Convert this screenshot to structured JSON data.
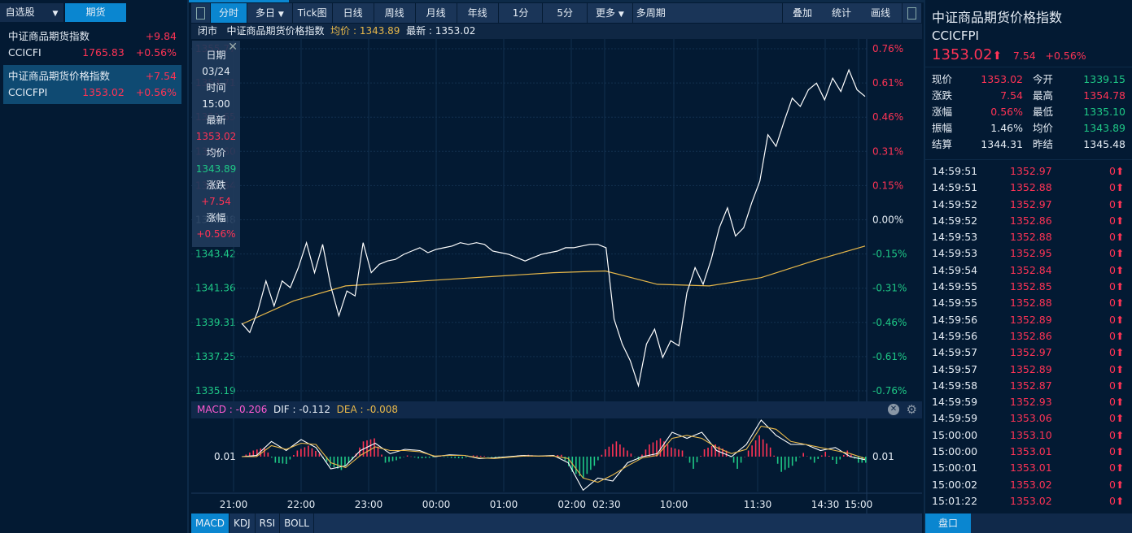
{
  "top_tabs": {
    "watchlist": "自选股",
    "futures": "期货"
  },
  "watchlist": [
    {
      "name": "中证商品期货指数",
      "code": "CCICFI",
      "price": "1765.83",
      "change": "+9.84",
      "pct": "+0.56%"
    },
    {
      "name": "中证商品期货价格指数",
      "code": "CCICFPI",
      "price": "1353.02",
      "change": "+7.54",
      "pct": "+0.56%"
    }
  ],
  "toolbar": {
    "items": [
      "分时",
      "多日",
      "Tick图",
      "日线",
      "周线",
      "月线",
      "年线",
      "1分",
      "5分",
      "更多",
      "多周期"
    ],
    "right": [
      "叠加",
      "统计",
      "画线"
    ]
  },
  "chart_header": {
    "status": "闭市",
    "name": "中证商品期货价格指数",
    "avg_label": "均价 : ",
    "avg": "1343.89",
    "last_label": "最新 : ",
    "last": "1353.02"
  },
  "tooltip": {
    "date_label": "日期",
    "date": "03/24",
    "time_label": "时间",
    "time": "15:00",
    "last_label": "最新",
    "last": "1353.02",
    "avg_label": "均价",
    "avg": "1343.89",
    "chg_label": "涨跌",
    "chg": "+7.54",
    "pct_label": "涨幅",
    "pct": "+0.56%"
  },
  "macd_header": {
    "macd": "MACD : -0.206",
    "dif": "DIF : -0.112",
    "dea": "DEA : -0.008"
  },
  "bottom_tabs": [
    "MACD",
    "KDJ",
    "RSI",
    "BOLL"
  ],
  "right_panel": {
    "name": "中证商品期货价格指数",
    "code": "CCICFPI",
    "price": "1353.02",
    "change": "7.54",
    "pct": "+0.56%",
    "stats": [
      [
        "现价",
        "1353.02",
        "red",
        "今开",
        "1339.15",
        "green"
      ],
      [
        "涨跌",
        "7.54",
        "red",
        "最高",
        "1354.78",
        "red"
      ],
      [
        "涨幅",
        "0.56%",
        "red",
        "最低",
        "1335.10",
        "green"
      ],
      [
        "振幅",
        "1.46%",
        "white",
        "均价",
        "1343.89",
        "green"
      ],
      [
        "结算",
        "1344.31",
        "white",
        "昨结",
        "1345.48",
        "white"
      ]
    ],
    "trades": [
      [
        "14:59:51",
        "1352.97",
        "0"
      ],
      [
        "14:59:51",
        "1352.88",
        "0"
      ],
      [
        "14:59:52",
        "1352.97",
        "0"
      ],
      [
        "14:59:52",
        "1352.86",
        "0"
      ],
      [
        "14:59:53",
        "1352.88",
        "0"
      ],
      [
        "14:59:53",
        "1352.95",
        "0"
      ],
      [
        "14:59:54",
        "1352.84",
        "0"
      ],
      [
        "14:59:55",
        "1352.85",
        "0"
      ],
      [
        "14:59:55",
        "1352.88",
        "0"
      ],
      [
        "14:59:56",
        "1352.89",
        "0"
      ],
      [
        "14:59:56",
        "1352.86",
        "0"
      ],
      [
        "14:59:57",
        "1352.97",
        "0"
      ],
      [
        "14:59:57",
        "1352.89",
        "0"
      ],
      [
        "14:59:58",
        "1352.87",
        "0"
      ],
      [
        "14:59:59",
        "1352.93",
        "0"
      ],
      [
        "14:59:59",
        "1353.06",
        "0"
      ],
      [
        "15:00:00",
        "1353.10",
        "0"
      ],
      [
        "15:00:00",
        "1353.01",
        "0"
      ],
      [
        "15:00:01",
        "1353.01",
        "0"
      ],
      [
        "15:00:02",
        "1353.02",
        "0"
      ],
      [
        "15:01:22",
        "1353.02",
        "0"
      ]
    ],
    "tab": "盘口"
  },
  "colors": {
    "up": "#ff3355",
    "down": "#1ec886",
    "avg": "#e8b84a",
    "accent": "#0a86d0"
  },
  "chart_data": [
    {
      "type": "line",
      "title": "分时",
      "ylim": [
        1335.19,
        1355.77
      ],
      "y_ticks": [
        "1355.77",
        "1353.71",
        "1351.65",
        "1349.60",
        "1347.54",
        "1345.48",
        "1343.42",
        "1341.36",
        "1339.31",
        "1337.25",
        "1335.19"
      ],
      "pct_ticks": [
        "0.76%",
        "0.61%",
        "0.46%",
        "0.31%",
        "0.15%",
        "0.00%",
        "-0.15%",
        "-0.31%",
        "-0.46%",
        "-0.61%",
        "-0.76%"
      ],
      "x_ticks": [
        "21:00",
        "22:00",
        "23:00",
        "00:00",
        "01:00",
        "02:00",
        "02:30",
        "10:00",
        "11:30",
        "14:30",
        "15:00"
      ],
      "series": [
        {
          "name": "price",
          "values": [
            1339.25,
            1338.7,
            1340.0,
            1341.8,
            1340.3,
            1341.8,
            1341.4,
            1342.6,
            1344.1,
            1342.3,
            1344.0,
            1341.5,
            1339.7,
            1341.2,
            1340.9,
            1344.1,
            1342.3,
            1342.8,
            1343.0,
            1343.1,
            1343.4,
            1343.6,
            1343.8,
            1343.5,
            1343.7,
            1343.8,
            1343.9,
            1344.1,
            1344.0,
            1344.1,
            1344.0,
            1343.6,
            1343.5,
            1343.4,
            1343.2,
            1343.0,
            1343.2,
            1343.4,
            1343.5,
            1343.6,
            1343.8,
            1343.8,
            1343.9,
            1344.0,
            1344.0,
            1343.8,
            1339.5,
            1338.0,
            1337.0,
            1335.5,
            1338.0,
            1338.9,
            1337.2,
            1338.2,
            1337.9,
            1341.1,
            1342.6,
            1341.6,
            1343.1,
            1345.0,
            1346.2,
            1344.5,
            1345.0,
            1346.5,
            1347.8,
            1350.6,
            1349.9,
            1351.4,
            1352.8,
            1352.3,
            1353.3,
            1353.7,
            1352.7,
            1354.0,
            1353.2,
            1354.5,
            1353.3,
            1352.9
          ]
        },
        {
          "name": "average",
          "values": [
            1339.2,
            1340.6,
            1341.5,
            1341.7,
            1341.9,
            1342.1,
            1342.3,
            1342.4,
            1341.6,
            1341.5,
            1342.0,
            1343.0,
            1343.9
          ]
        }
      ]
    },
    {
      "type": "bar",
      "title": "MACD",
      "y_tick": "0.01",
      "ylim": [
        -0.6,
        0.6
      ],
      "histogram": [
        0,
        0.1,
        0.15,
        -0.1,
        -0.12,
        0.1,
        0.18,
        0.05,
        -0.15,
        -0.22,
        -0.05,
        0.25,
        0.3,
        -0.1,
        -0.06,
        0.02,
        -0.03,
        -0.02,
        0.01,
        -0.02,
        -0.03,
        0.02,
        0.01,
        -0.02,
        -0.01,
        0.02,
        0.03,
        0.01,
        0.02,
        0.03,
        -0.25,
        -0.35,
        -0.15,
        0.12,
        0.25,
        0.1,
        -0.05,
        0.2,
        0.3,
        0.15,
        0.1,
        -0.2,
        0.12,
        0.2,
        0.1,
        -0.2,
        0.1,
        0.35,
        0.15,
        -0.25,
        -0.15,
        0.06,
        -0.1,
        0.08,
        -0.12,
        0.1,
        -0.1
      ],
      "series": [
        {
          "name": "DIF",
          "values": [
            0,
            0.02,
            0.25,
            0.1,
            0.28,
            0.15,
            -0.2,
            -0.15,
            0.1,
            0.22,
            0.05,
            0.12,
            0.1,
            0.0,
            0.03,
            0.02,
            -0.03,
            -0.02,
            0.0,
            0.02,
            0.01,
            0.02,
            -0.1,
            -0.55,
            -0.35,
            -0.4,
            -0.1,
            0.0,
            0.05,
            0.4,
            0.3,
            0.4,
            0.1,
            0.0,
            0.2,
            0.6,
            0.35,
            0.2,
            0.2,
            0.1,
            0.15,
            0.0,
            -0.05
          ]
        },
        {
          "name": "DEA",
          "values": [
            0,
            0.0,
            0.18,
            0.12,
            0.22,
            0.2,
            -0.1,
            -0.18,
            0.02,
            0.16,
            0.1,
            0.1,
            0.08,
            0.01,
            0.02,
            0.02,
            -0.02,
            -0.03,
            -0.01,
            0.01,
            0.01,
            0.01,
            -0.03,
            -0.35,
            -0.42,
            -0.3,
            -0.15,
            -0.02,
            0.02,
            0.3,
            0.35,
            0.3,
            0.15,
            0.05,
            0.12,
            0.5,
            0.45,
            0.25,
            0.2,
            0.15,
            0.1,
            0.05,
            -0.03
          ]
        }
      ]
    }
  ]
}
